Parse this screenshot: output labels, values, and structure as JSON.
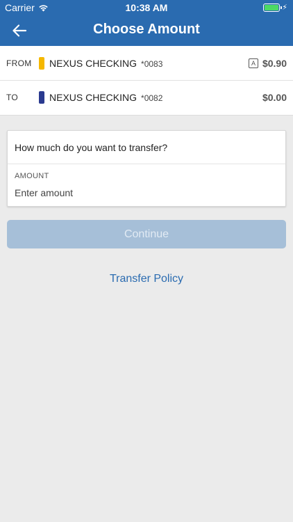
{
  "status_bar": {
    "carrier": "Carrier",
    "time": "10:38 AM",
    "battery_icon": "battery-full-icon",
    "charge_glyph": "⚡"
  },
  "header": {
    "title": "Choose Amount",
    "back_icon": "arrow-left-icon",
    "background_color": "#2a6bb0"
  },
  "accounts": {
    "from": {
      "direction": "FROM",
      "name": "NEXUS CHECKING",
      "number": "*0083",
      "color": "#f5b800",
      "badge": "A",
      "balance": "$0.90"
    },
    "to": {
      "direction": "TO",
      "name": "NEXUS CHECKING",
      "number": "*0082",
      "color": "#2a3a8f",
      "balance": "$0.00"
    }
  },
  "amount_card": {
    "question": "How much do you want to transfer?",
    "label": "AMOUNT",
    "placeholder": "Enter amount",
    "value": ""
  },
  "actions": {
    "continue_label": "Continue",
    "policy_label": "Transfer Policy"
  }
}
